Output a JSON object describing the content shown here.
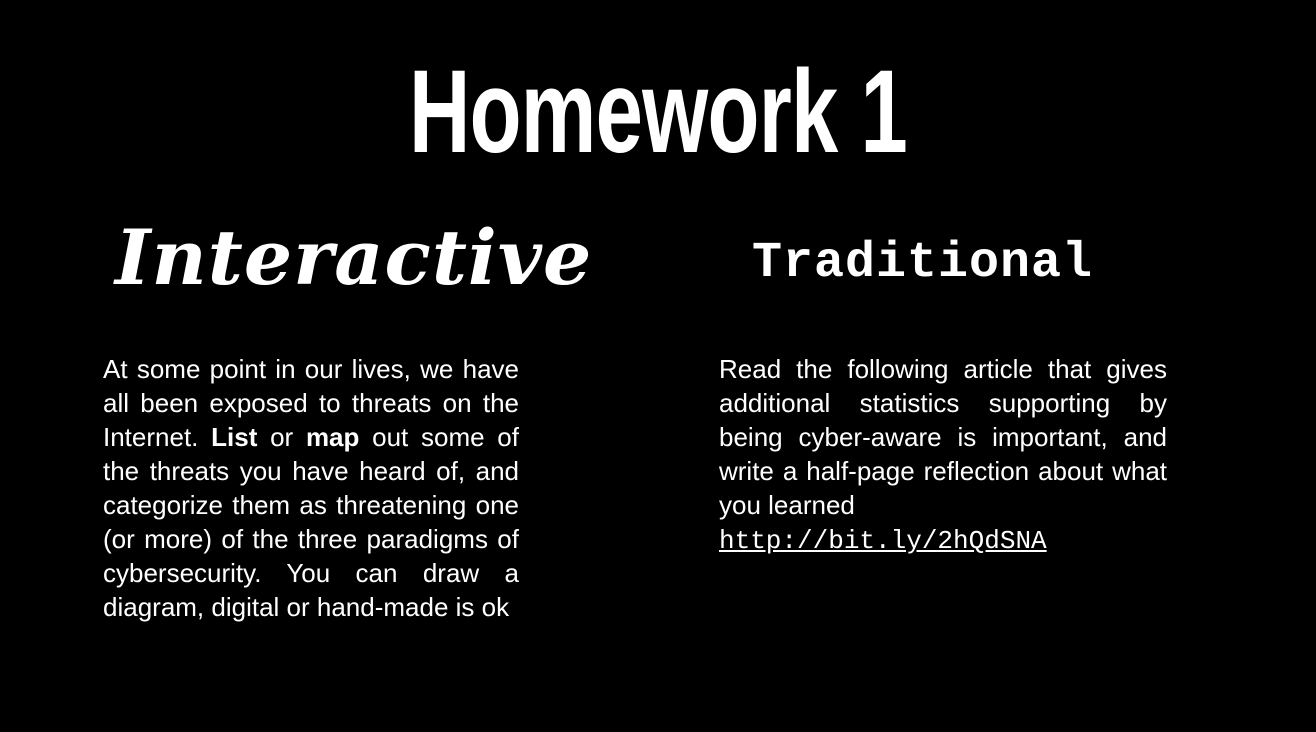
{
  "slide": {
    "title": "Homework 1",
    "interactive": {
      "heading": "Interactive",
      "text_1": "At some point in our lives, we have all been exposed to threats on the Internet. ",
      "bold_1": "List",
      "text_2": " or ",
      "bold_2": "map",
      "text_3": " out some of the threats you have heard of, and categorize them as threatening one (or more) of the three paradigms of cybersecurity. You can draw a diagram, digital or hand-made is ok"
    },
    "traditional": {
      "heading": "Traditional",
      "text": "Read the following article that gives additional statistics supporting by being cyber-aware is important, and write a half-page reflection about what you learned",
      "link": "http://bit.ly/2hQdSNA"
    }
  },
  "colors": {
    "background": "#000000",
    "text": "#ffffff"
  }
}
